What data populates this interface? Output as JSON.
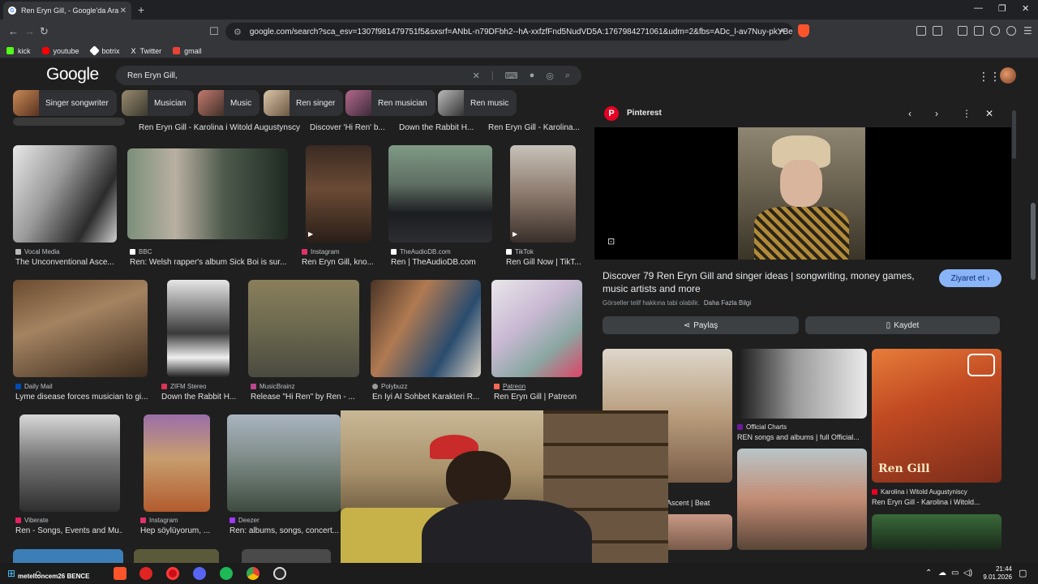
{
  "browser": {
    "tab_title": "Ren Eryn Gill, - Google'da Ara",
    "tab_close": "✕",
    "new_tab": "+",
    "url": "google.com/search?sca_esv=1307f981479751f5&sxsrf=ANbL-n79DFbh2--hA-xxfzfFnd5NudVD5A:1767984271061&udm=2&fbs=ADc_l-av7Nuy-pkYBedg6...",
    "bookmarks": [
      {
        "label": "kick",
        "color": "#53fc18"
      },
      {
        "label": "youtube",
        "color": "#ff0000"
      },
      {
        "label": "botrix",
        "color": "#ffffff"
      },
      {
        "label": "Twitter",
        "color": "#ffffff"
      },
      {
        "label": "gmail",
        "color": "#ea4335"
      }
    ]
  },
  "google": {
    "logo": "Google",
    "query": "Ren Eryn Gill,",
    "chips": [
      "Singer songwriter",
      "Musician",
      "Music",
      "Ren singer",
      "Ren musician",
      "Ren music"
    ]
  },
  "results": {
    "row0_titles": [
      "Ren Eryn Gill - Karolina i Witold Augustynscy",
      "Discover 'Hi Ren' b...",
      "Down the Rabbit H...",
      "Ren Eryn Gill - Karolina..."
    ],
    "row1": [
      {
        "source": "Vocal Media",
        "title": "The Unconventional Asce...",
        "color": "#bbbbbb"
      },
      {
        "source": "BBC",
        "title": "Ren: Welsh rapper's album Sick Boi is sur...",
        "color": "#ffffff"
      },
      {
        "source": "Instagram",
        "title": "Ren Eryn Gill, kno...",
        "color": "#e1306c"
      },
      {
        "source": "TheAudioDB.com",
        "title": "Ren | TheAudioDB.com",
        "color": "#ffffff"
      },
      {
        "source": "TikTok",
        "title": "Ren Gill Now | TikT...",
        "color": "#ffffff"
      }
    ],
    "row2": [
      {
        "source": "Daily Mail",
        "title": "Lyme disease forces musician to gi...",
        "color": "#004db3"
      },
      {
        "source": "ZIFM Stereo",
        "title": "Down the Rabbit H...",
        "color": "#d35"
      },
      {
        "source": "MusicBrainz",
        "title": "Release \"Hi Ren\" by Ren - ...",
        "color": "#ba478f"
      },
      {
        "source": "Polybuzz",
        "title": "En İyi AI Sohbet Karakteri R...",
        "color": "#999"
      },
      {
        "source": "Patreon",
        "title": "Ren Eryn Gill | Patreon",
        "color": "#f96854"
      }
    ],
    "row3": [
      {
        "source": "Viberate",
        "title": "Ren - Songs, Events and Mu...",
        "color": "#e91e63"
      },
      {
        "source": "Instagram",
        "title": "Hep söylüyorum, ...",
        "color": "#e1306c"
      },
      {
        "source": "Deezer",
        "title": "Ren: albums, songs, concert...",
        "color": "#a238ff"
      }
    ]
  },
  "panel": {
    "source": "Pinterest",
    "title": "Discover 79 Ren Eryn Gill and singer ideas | songwriting, money games, music artists and more",
    "notice": "Görseller telif hakkına tabi olabilir.",
    "notice_link": "Daha Fazla Bilgi",
    "visit_label": "Ziyaret et",
    "share_label": "Paylaş",
    "save_label": "Kaydet",
    "related": [
      {
        "source": "",
        "title": "Ascent | Beat"
      },
      {
        "source": "Official Charts",
        "title": "REN songs and albums | full Official..."
      },
      {
        "source": "Karolina i Witold Augustyniscy",
        "title": "Ren Eryn Gill - Karolina i Witold..."
      }
    ],
    "overlay_text": "Ren Gill"
  },
  "taskbar": {
    "user_label": "meteltoncem26",
    "user_label2": "BENCE",
    "time": "21:44",
    "date": "9.01.2026"
  }
}
